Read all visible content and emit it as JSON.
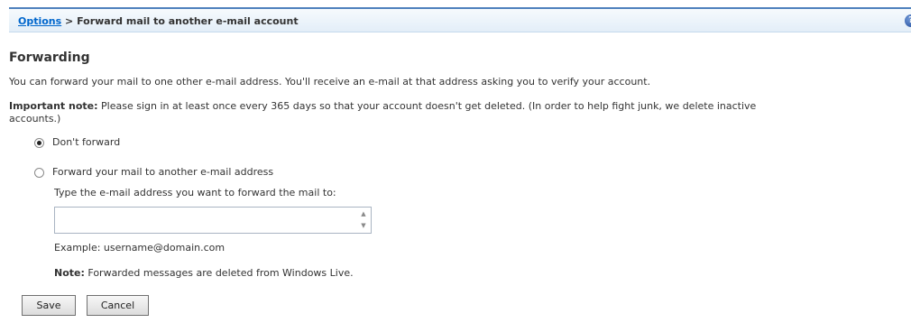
{
  "breadcrumb": {
    "link": "Options",
    "separator": " > ",
    "current": "Forward mail to another e-mail account"
  },
  "help_icon": "?",
  "page": {
    "heading": "Forwarding",
    "intro": "You can forward your mail to one other e-mail address. You'll receive an e-mail at that address asking you to verify your account.",
    "important_label": "Important note:",
    "important_text_line1": " Please sign in at least once every 365 days so that your account doesn't get deleted. (In order to help fight junk, we delete inactive",
    "important_text_line2": "accounts.)"
  },
  "options": {
    "dont_forward": "Don't forward",
    "forward": "Forward your mail to another e-mail address",
    "selected": "dont_forward"
  },
  "forward_form": {
    "prompt": "Type the e-mail address you want to forward the mail to:",
    "value": "",
    "example": "Example: username@domain.com",
    "note_label": "Note:",
    "note_text": " Forwarded messages are deleted from Windows Live."
  },
  "buttons": {
    "save": "Save",
    "cancel": "Cancel"
  }
}
